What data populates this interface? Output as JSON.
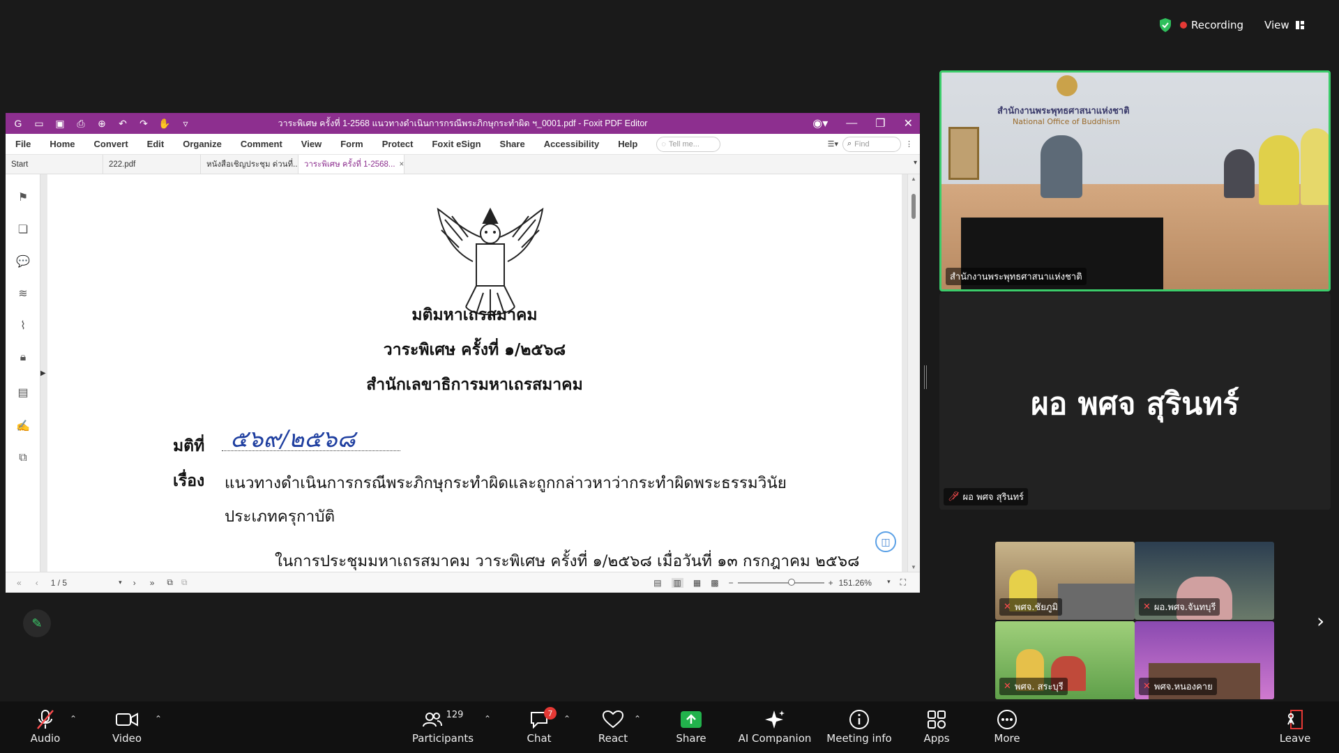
{
  "status": {
    "recording_label": "Recording",
    "view_label": "View"
  },
  "foxit": {
    "window_title": "วาระพิเศษ ครั้งที่ 1-2568 แนวทางดำเนินการกรณีพระภิกษุกระทำผิด ฯ_0001.pdf - Foxit PDF Editor",
    "menu": [
      "File",
      "Home",
      "Convert",
      "Edit",
      "Organize",
      "Comment",
      "View",
      "Form",
      "Protect",
      "Foxit eSign",
      "Share",
      "Accessibility",
      "Help"
    ],
    "tell_me_placeholder": "Tell me...",
    "find_placeholder": "Find",
    "tabs": [
      "Start",
      "222.pdf",
      "หนังสือเชิญประชุม ด่วนที่...",
      "วาระพิเศษ ครั้งที่ 1-2568..."
    ],
    "page_indicator": "1 / 5",
    "zoom_level": "151.26%"
  },
  "document": {
    "org": "มติมหาเถรสมาคม",
    "session": "วาระพิเศษ ครั้งที่ ๑/๒๕๖๘",
    "office": "สำนักเลขาธิการมหาเถรสมาคม",
    "resolution_label": "มติที่",
    "resolution_no": "๕๖๙/๒๕๖๘",
    "subject_label": "เรื่อง",
    "subject_line1": "แนวทางดำเนินการกรณีพระภิกษุกระทำผิดและถูกกล่าวหาว่ากระทำผิดพระธรรมวินัย",
    "subject_line2": "ประเภทครุกาบัติ",
    "body_line1": "ในการประชุมมหาเถรสมาคม วาระพิเศษ ครั้งที่ ๑/๒๕๖๘ เมื่อวันที่ ๑๓ กรกฎาคม ๒๕๖๘"
  },
  "meeting": {
    "main_tile_name": "สำนักงานพระพุทธศาสนาแห่งชาติ",
    "main_sign_th": "สำนักงานพระพุทธศาสนาแห่งชาติ",
    "main_sign_en": "National Office of Buddhism",
    "speaker_display": "ผอ พศจ สุรินทร์",
    "speaker_tag": "ผอ พศจ สุรินทร์",
    "thumbnails": [
      "พศจ.ชัยภูมิ",
      "ผอ.พศจ.จันทบุรี",
      "พศจ. สระบุรี",
      "พศจ.หนองคาย"
    ]
  },
  "toolbar": {
    "audio": "Audio",
    "video": "Video",
    "participants": "Participants",
    "participants_count": "129",
    "chat": "Chat",
    "chat_badge": "7",
    "react": "React",
    "share": "Share",
    "ai_companion": "AI Companion",
    "meeting_info": "Meeting info",
    "apps": "Apps",
    "more": "More",
    "leave": "Leave"
  },
  "colors": {
    "foxit_purple": "#8d2f8f",
    "active_speaker_border": "#3ccd6b",
    "share_green": "#22b24c",
    "mute_red": "#ff4d4f"
  }
}
